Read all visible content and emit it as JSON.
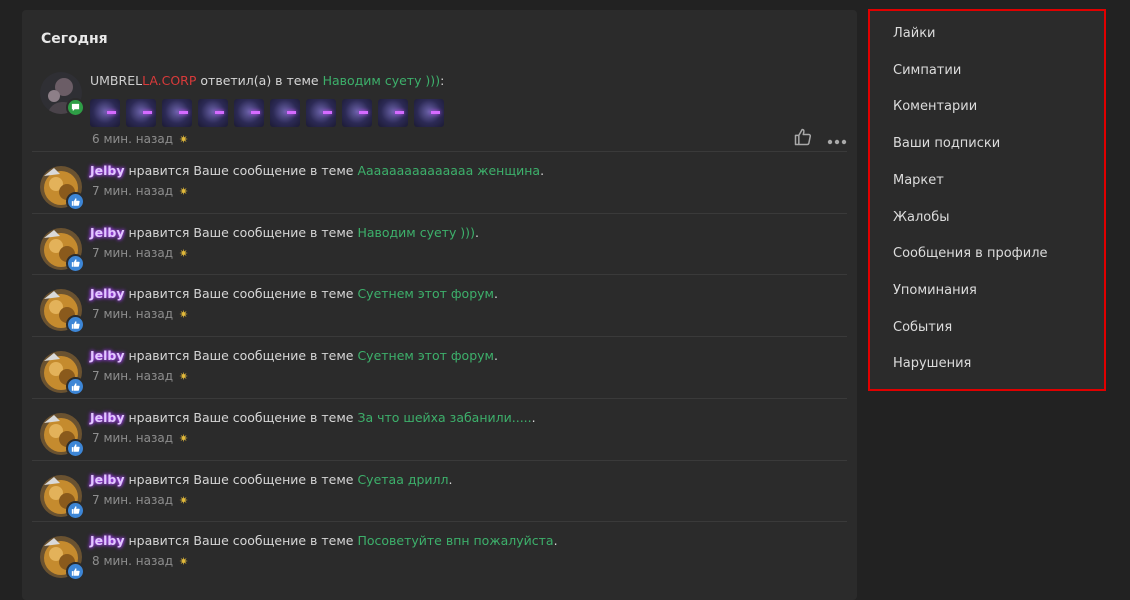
{
  "feed": {
    "section_title": "Сегодня",
    "first": {
      "user_part1": "UMBREL",
      "user_part2": "LA.CORP",
      "action": " ответил(а) в теме ",
      "topic": "Наводим суету )))",
      "suffix": ":",
      "emoji_count": 10,
      "time": "6 мин. назад",
      "star": "✷"
    },
    "likes": [
      {
        "user": "Jelby",
        "action": " нравится Ваше сообщение в теме ",
        "topic": "Ааааааааааааааа женщина",
        "suffix": ".",
        "time": "7 мин. назад",
        "star": "✷"
      },
      {
        "user": "Jelby",
        "action": " нравится Ваше сообщение в теме ",
        "topic": "Наводим суету )))",
        "suffix": ".",
        "time": "7 мин. назад",
        "star": "✷"
      },
      {
        "user": "Jelby",
        "action": " нравится Ваше сообщение в теме ",
        "topic": "Суетнем этот форум",
        "suffix": ".",
        "time": "7 мин. назад",
        "star": "✷"
      },
      {
        "user": "Jelby",
        "action": " нравится Ваше сообщение в теме ",
        "topic": "Суетнем этот форум",
        "suffix": ".",
        "time": "7 мин. назад",
        "star": "✷"
      },
      {
        "user": "Jelby",
        "action": " нравится Ваше сообщение в теме ",
        "topic": "За что шейха забанили.....",
        "suffix": ".",
        "time": "7 мин. назад",
        "star": "✷"
      },
      {
        "user": "Jelby",
        "action": " нравится Ваше сообщение в теме ",
        "topic": "Суетаа дрилл",
        "suffix": ".",
        "time": "7 мин. назад",
        "star": "✷"
      },
      {
        "user": "Jelby",
        "action": " нравится Ваше сообщение в теме ",
        "topic": "Посоветуйте впн пожалуйста",
        "suffix": ".",
        "time": "8 мин. назад",
        "star": "✷"
      }
    ]
  },
  "sidebar": {
    "items": [
      {
        "label": "Лайки"
      },
      {
        "label": "Симпатии"
      },
      {
        "label": "Коментарии"
      },
      {
        "label": "Ваши подписки"
      },
      {
        "label": "Маркет"
      },
      {
        "label": "Жалобы"
      },
      {
        "label": "Сообщения в профиле"
      },
      {
        "label": "Упоминания"
      },
      {
        "label": "События"
      },
      {
        "label": "Нарушения"
      }
    ]
  },
  "colors": {
    "topic": "#3db06b",
    "highlight_border": "#e00000",
    "like_badge": "#3d86d6",
    "reply_badge": "#2e9e46"
  }
}
